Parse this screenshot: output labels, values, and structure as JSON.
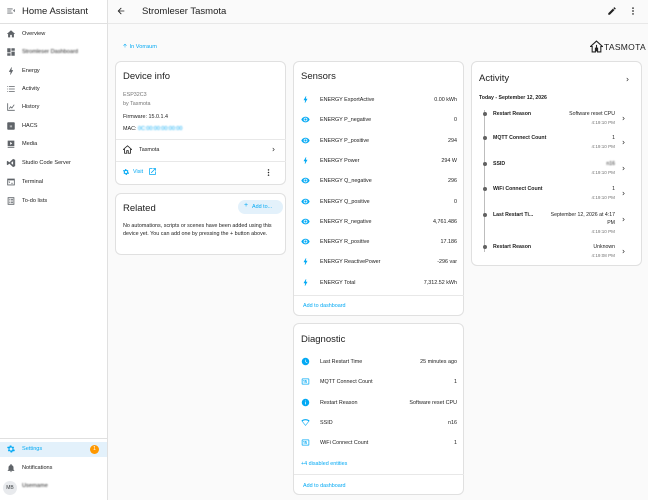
{
  "app": {
    "title": "Home Assistant"
  },
  "sidebar": {
    "items": [
      {
        "label": "Overview",
        "icon": "home-icon"
      },
      {
        "label": "Stromleser Dashboard",
        "icon": "dashboard-icon",
        "blurred": true
      },
      {
        "label": "Energy",
        "icon": "energy-icon"
      },
      {
        "label": "Activity",
        "icon": "activity-icon"
      },
      {
        "label": "History",
        "icon": "history-icon"
      },
      {
        "label": "HACS",
        "icon": "hacs-icon"
      },
      {
        "label": "Media",
        "icon": "media-icon"
      },
      {
        "label": "Studio Code Server",
        "icon": "vscode-icon"
      },
      {
        "label": "Terminal",
        "icon": "terminal-icon"
      },
      {
        "label": "To-do lists",
        "icon": "todo-icon"
      }
    ],
    "settings": {
      "label": "Settings",
      "badge": "1"
    },
    "notifications": {
      "label": "Notifications"
    },
    "user": {
      "initials": "MB",
      "name": "Username"
    }
  },
  "topbar": {
    "title": "Stromleser Tasmota"
  },
  "breadcrumb": "In Vorraum",
  "logo": {
    "text": "TASMOTA"
  },
  "device_info": {
    "title": "Device info",
    "model": "ESP32C3",
    "manufacturer": "by Tasmota",
    "firmware": "Firmware: 15.0.1.4",
    "mac_label": "MAC:",
    "mac_value": "0C:00:00:00:00:00",
    "integration": "Tasmota",
    "visit": "Visit"
  },
  "related": {
    "title": "Related",
    "add_button": "Add to...",
    "text": "No automations, scripts or scenes have been added using this device yet. You can add one by pressing the + button above."
  },
  "sensors": {
    "title": "Sensors",
    "rows": [
      {
        "icon": "flash-icon",
        "label": "ENERGY ExportActive",
        "value": "0.00 kWh"
      },
      {
        "icon": "eye-icon",
        "label": "ENERGY P_negative",
        "value": "0"
      },
      {
        "icon": "eye-icon",
        "label": "ENERGY P_positive",
        "value": "294"
      },
      {
        "icon": "flash-icon",
        "label": "ENERGY Power",
        "value": "294 W"
      },
      {
        "icon": "eye-icon",
        "label": "ENERGY Q_negative",
        "value": "296"
      },
      {
        "icon": "eye-icon",
        "label": "ENERGY Q_positive",
        "value": "0"
      },
      {
        "icon": "eye-icon",
        "label": "ENERGY R_negative",
        "value": "4,761.486"
      },
      {
        "icon": "eye-icon",
        "label": "ENERGY R_positive",
        "value": "17.186"
      },
      {
        "icon": "flash-icon",
        "label": "ENERGY ReactivePower",
        "value": "-296 var"
      },
      {
        "icon": "flash-icon",
        "label": "ENERGY Total",
        "value": "7,312.52 kWh"
      }
    ],
    "add_link": "Add to dashboard"
  },
  "diagnostic": {
    "title": "Diagnostic",
    "rows": [
      {
        "icon": "clock-icon",
        "label": "Last Restart Time",
        "value": "25 minutes ago"
      },
      {
        "icon": "counter-icon",
        "label": "MQTT Connect Count",
        "value": "1"
      },
      {
        "icon": "info-icon",
        "label": "Restart Reason",
        "value": "Software reset CPU"
      },
      {
        "icon": "wifi-icon",
        "label": "SSID",
        "value": "n16"
      },
      {
        "icon": "counter-icon",
        "label": "WiFi Connect Count",
        "value": "1"
      }
    ],
    "disabled_link": "+4 disabled entities",
    "add_link": "Add to dashboard"
  },
  "activity": {
    "title": "Activity",
    "date": "Today - September 12, 2026",
    "entries": [
      {
        "label": "Restart Reason",
        "value": "Software reset CPU",
        "time": "4:19:10 PM"
      },
      {
        "label": "MQTT Connect Count",
        "value": "1",
        "time": "4:19:10 PM"
      },
      {
        "label": "SSID",
        "value": "n16",
        "time": "4:19:10 PM"
      },
      {
        "label": "WiFi Connect Count",
        "value": "1",
        "time": "4:19:10 PM"
      },
      {
        "label": "Last Restart Ti...",
        "value": "September 12, 2026 at 4:17",
        "value2": "PM",
        "time": "4:19:10 PM"
      },
      {
        "label": "Restart Reason",
        "value": "Unknown",
        "time": "4:19:08 PM"
      }
    ]
  },
  "colors": {
    "accent": "#03a9f4",
    "badge": "#ff9800",
    "icon": "#5f6368"
  }
}
